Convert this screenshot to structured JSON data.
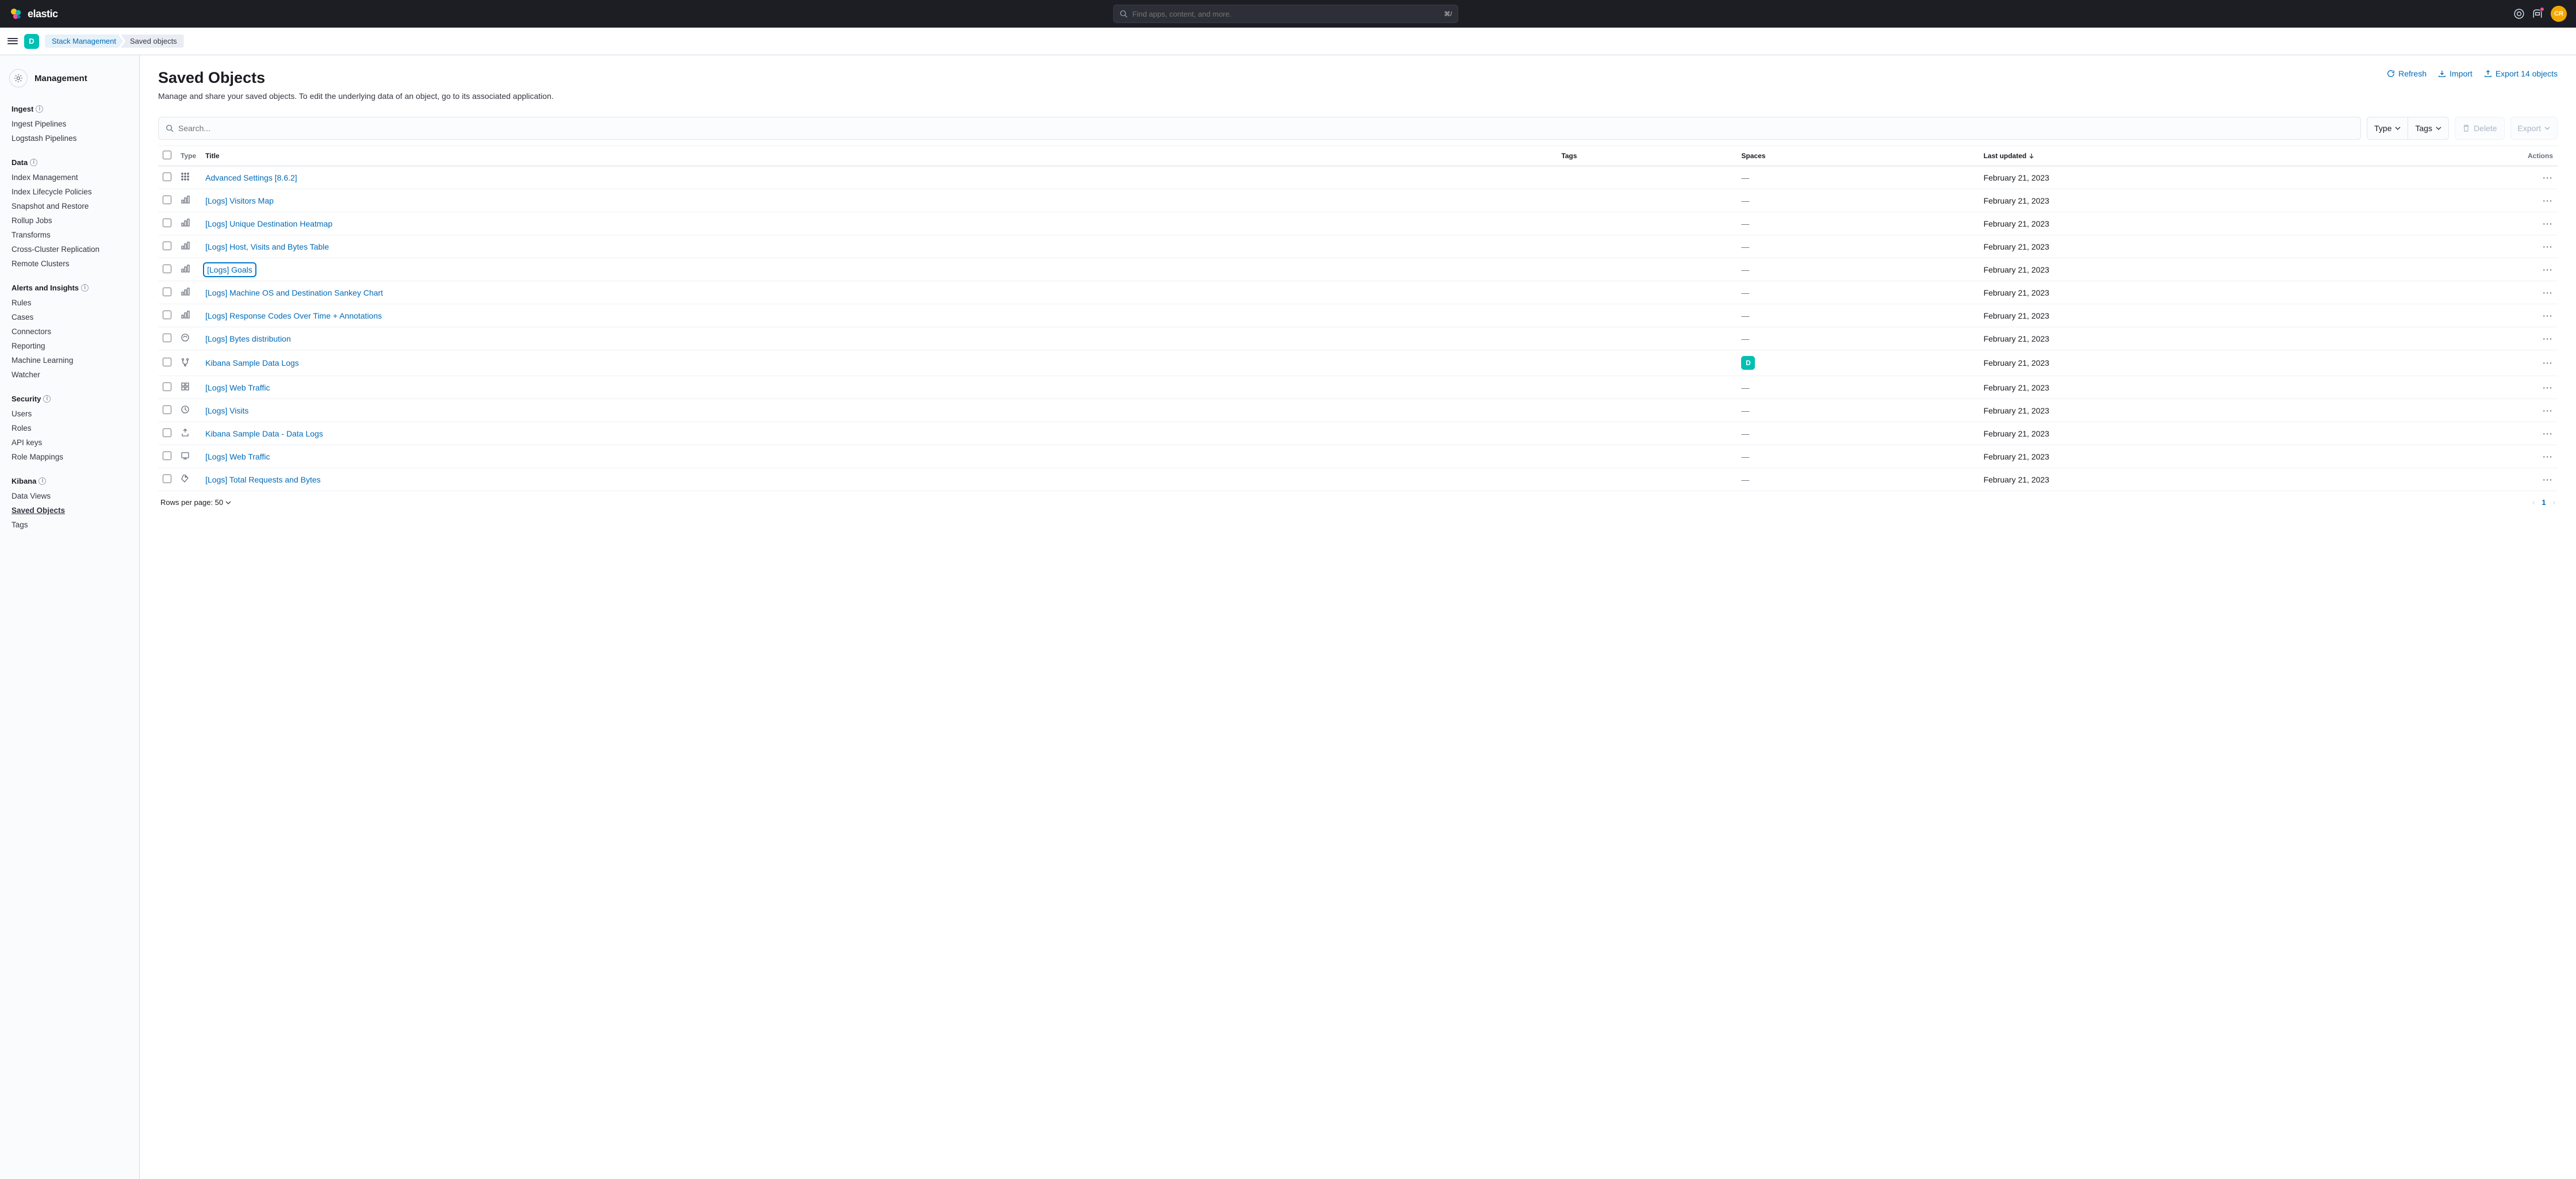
{
  "header": {
    "logo_text": "elastic",
    "search_placeholder": "Find apps, content, and more.",
    "search_shortcut": "⌘/",
    "avatar_initials": "CR"
  },
  "subheader": {
    "space_initial": "D",
    "breadcrumbs": [
      "Stack Management",
      "Saved objects"
    ]
  },
  "sidebar": {
    "title": "Management",
    "groups": [
      {
        "title": "Ingest",
        "info": true,
        "items": [
          "Ingest Pipelines",
          "Logstash Pipelines"
        ]
      },
      {
        "title": "Data",
        "info": true,
        "items": [
          "Index Management",
          "Index Lifecycle Policies",
          "Snapshot and Restore",
          "Rollup Jobs",
          "Transforms",
          "Cross-Cluster Replication",
          "Remote Clusters"
        ]
      },
      {
        "title": "Alerts and Insights",
        "info": true,
        "items": [
          "Rules",
          "Cases",
          "Connectors",
          "Reporting",
          "Machine Learning",
          "Watcher"
        ]
      },
      {
        "title": "Security",
        "info": true,
        "items": [
          "Users",
          "Roles",
          "API keys",
          "Role Mappings"
        ]
      },
      {
        "title": "Kibana",
        "info": true,
        "items": [
          "Data Views",
          "Saved Objects",
          "Tags"
        ],
        "active": "Saved Objects"
      }
    ]
  },
  "page": {
    "title": "Saved Objects",
    "desc": "Manage and share your saved objects. To edit the underlying data of an object, go to its associated application.",
    "actions": {
      "refresh": "Refresh",
      "import": "Import",
      "export": "Export 14 objects"
    }
  },
  "toolbar": {
    "search_placeholder": "Search...",
    "type": "Type",
    "tags": "Tags",
    "delete": "Delete",
    "export": "Export"
  },
  "table": {
    "columns": {
      "type": "Type",
      "title": "Title",
      "tags": "Tags",
      "spaces": "Spaces",
      "last_updated": "Last updated",
      "actions": "Actions"
    },
    "rows": [
      {
        "icon": "config",
        "title": "Advanced Settings [8.6.2]",
        "tags": "",
        "spaces": "—",
        "updated": "February 21, 2023",
        "focused": false
      },
      {
        "icon": "vis",
        "title": "[Logs] Visitors Map",
        "tags": "",
        "spaces": "—",
        "updated": "February 21, 2023",
        "focused": false
      },
      {
        "icon": "vis",
        "title": "[Logs] Unique Destination Heatmap",
        "tags": "",
        "spaces": "—",
        "updated": "February 21, 2023",
        "focused": false
      },
      {
        "icon": "vis",
        "title": "[Logs] Host, Visits and Bytes Table",
        "tags": "",
        "spaces": "—",
        "updated": "February 21, 2023",
        "focused": false
      },
      {
        "icon": "vis",
        "title": "[Logs] Goals",
        "tags": "",
        "spaces": "—",
        "updated": "February 21, 2023",
        "focused": true
      },
      {
        "icon": "vis",
        "title": "[Logs] Machine OS and Destination Sankey Chart",
        "tags": "",
        "spaces": "—",
        "updated": "February 21, 2023",
        "focused": false
      },
      {
        "icon": "vis",
        "title": "[Logs] Response Codes Over Time + Annotations",
        "tags": "",
        "spaces": "—",
        "updated": "February 21, 2023",
        "focused": false
      },
      {
        "icon": "lens",
        "title": "[Logs] Bytes distribution",
        "tags": "",
        "spaces": "—",
        "updated": "February 21, 2023",
        "focused": false
      },
      {
        "icon": "index",
        "title": "Kibana Sample Data Logs",
        "tags": "",
        "spaces": "D",
        "updated": "February 21, 2023",
        "focused": false
      },
      {
        "icon": "dashboard",
        "title": "[Logs] Web Traffic",
        "tags": "",
        "spaces": "—",
        "updated": "February 21, 2023",
        "focused": false
      },
      {
        "icon": "search",
        "title": "[Logs] Visits",
        "tags": "",
        "spaces": "—",
        "updated": "February 21, 2023",
        "focused": false
      },
      {
        "icon": "link",
        "title": "Kibana Sample Data - Data Logs",
        "tags": "",
        "spaces": "—",
        "updated": "February 21, 2023",
        "focused": false
      },
      {
        "icon": "canvas",
        "title": "[Logs] Web Traffic",
        "tags": "",
        "spaces": "—",
        "updated": "February 21, 2023",
        "focused": false
      },
      {
        "icon": "tag",
        "title": "[Logs] Total Requests and Bytes",
        "tags": "",
        "spaces": "—",
        "updated": "February 21, 2023",
        "focused": false
      }
    ]
  },
  "footer": {
    "rows_per_page": "Rows per page: 50",
    "current_page": "1"
  }
}
